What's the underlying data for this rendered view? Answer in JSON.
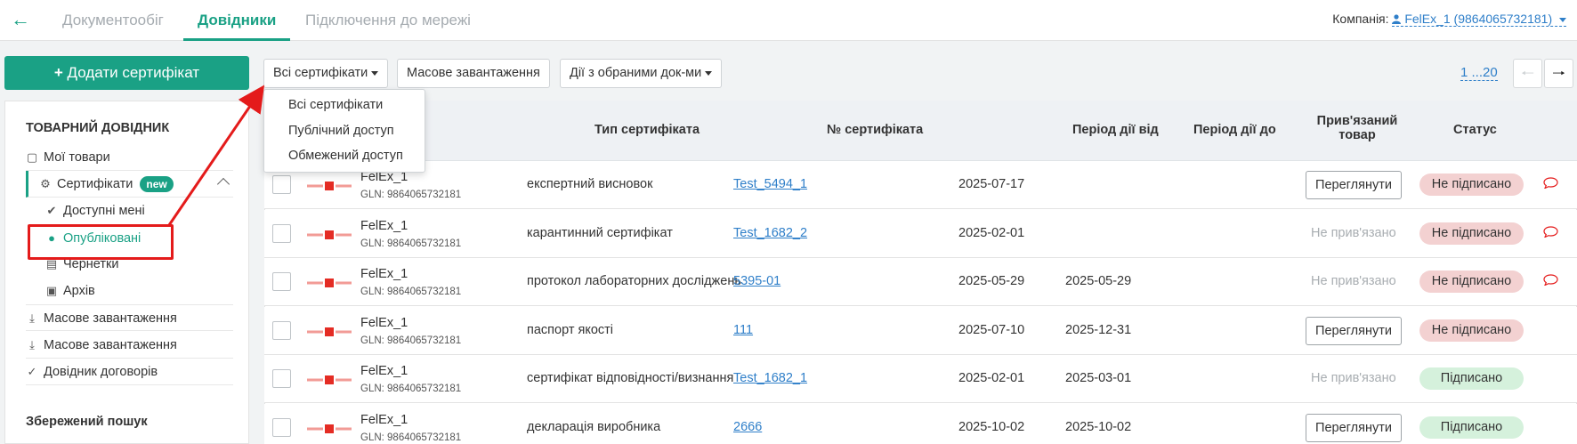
{
  "nav": {
    "back_icon": "arrow-left-icon",
    "tabs": [
      {
        "label": "Документообіг",
        "active": false
      },
      {
        "label": "Довідники",
        "active": true
      },
      {
        "label": "Підключення до мережі",
        "active": false
      }
    ],
    "company_label": "Компанія:",
    "company_value": "FelEx_1 (9864065732181)"
  },
  "actions": {
    "add_button": "Додати сертифікат",
    "filter_button": "Всі сертифікати",
    "bulk_upload_button": "Масове завантаження",
    "bulk_actions_button": "Дії з обраними док-ми",
    "pagination": "1 ...20"
  },
  "dropdown": {
    "items": [
      "Всі сертифікати",
      "Публічний доступ",
      "Обмежений доступ"
    ]
  },
  "sidebar": {
    "section_title": "ТОВАРНИЙ ДОВІДНИК",
    "items": [
      {
        "label": "Мої товари",
        "icon": "box-icon"
      },
      {
        "label": "Сертифікати",
        "icon": "gear-icon",
        "badge": "new"
      },
      {
        "label": "Доступні мені",
        "icon": "check-circle-icon"
      },
      {
        "label": "Опубліковані",
        "icon": "users-icon"
      },
      {
        "label": "Чернетки",
        "icon": "document-icon"
      },
      {
        "label": "Архів",
        "icon": "archive-icon"
      },
      {
        "label": "Масове завантаження",
        "icon": "download-icon"
      },
      {
        "label": "Масове завантаження",
        "icon": "download-icon"
      },
      {
        "label": "Довідник договорів",
        "icon": "check-icon"
      }
    ],
    "saved_search_title": "Збережений пошук"
  },
  "table": {
    "headers": {
      "type": "Тип сертифіката",
      "number": "№ сертифіката",
      "from": "Період дії від",
      "to": "Період дії до",
      "linked_line1": "Прив'язаний",
      "linked_line2": "товар",
      "status": "Статус"
    },
    "view_label": "Переглянути",
    "not_linked_label": "Не прив'язано",
    "rows": [
      {
        "org": "FelEx_1",
        "gln": "GLN: 9864065732181",
        "type": "експертний висновок",
        "number": "Test_5494_1",
        "from": "2025-07-17",
        "to": "",
        "linked": "view",
        "status": "Не підписано",
        "comment": true
      },
      {
        "org": "FelEx_1",
        "gln": "GLN: 9864065732181",
        "type": "карантинний сертифікат",
        "number": "Test_1682_2",
        "from": "2025-02-01",
        "to": "",
        "linked": "none",
        "status": "Не підписано",
        "comment": true
      },
      {
        "org": "FelEx_1",
        "gln": "GLN: 9864065732181",
        "type": "протокол лабораторних досліджень",
        "number": "5395-01",
        "from": "2025-05-29",
        "to": "2025-05-29",
        "linked": "none",
        "status": "Не підписано",
        "comment": true
      },
      {
        "org": "FelEx_1",
        "gln": "GLN: 9864065732181",
        "type": "паспорт якості",
        "number": "111",
        "from": "2025-07-10",
        "to": "2025-12-31",
        "linked": "view",
        "status": "Не підписано",
        "comment": false
      },
      {
        "org": "FelEx_1",
        "gln": "GLN: 9864065732181",
        "type": "сертифікат відповідності/визнання",
        "number": "Test_1682_1",
        "from": "2025-02-01",
        "to": "2025-03-01",
        "linked": "none",
        "status": "Підписано",
        "comment": false
      },
      {
        "org": "FelEx_1",
        "gln": "GLN: 9864065732181",
        "type": "декларація виробника",
        "number": "2666",
        "from": "2025-10-02",
        "to": "2025-10-02",
        "linked": "view",
        "status": "Підписано",
        "comment": false
      }
    ]
  },
  "colors": {
    "accent": "#1aa185",
    "link": "#2f7fc9",
    "highlight": "#e41b1b",
    "status_bad": "#f3d1d1",
    "status_good": "#d5f1dc"
  }
}
